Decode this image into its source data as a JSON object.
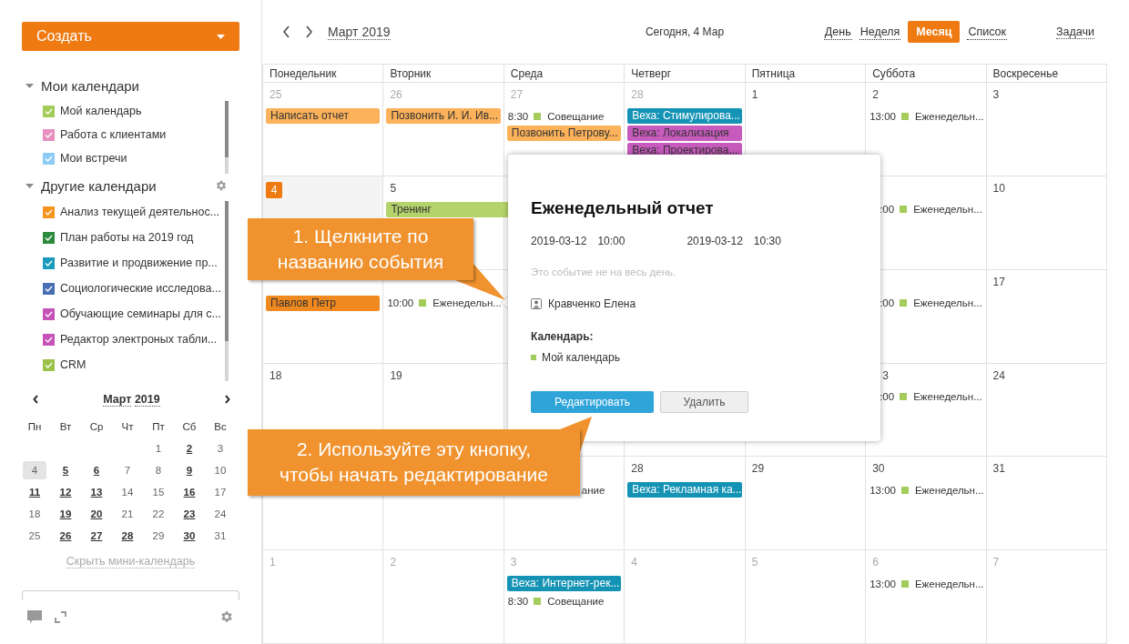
{
  "sidebar": {
    "create_button": "Создать",
    "sections": [
      {
        "title": "Мои календари",
        "expanded": true,
        "settings": false,
        "items": [
          {
            "label": "Мой календарь",
            "checked": true,
            "color": "#a4cc5a"
          },
          {
            "label": "Работа с клиентами",
            "checked": true,
            "color": "#e88fbf"
          },
          {
            "label": "Мои встречи",
            "checked": true,
            "color": "#8ecbf5"
          }
        ]
      },
      {
        "title": "Другие календари",
        "expanded": true,
        "settings": true,
        "items": [
          {
            "label": "Анализ текущей деятельнос...",
            "checked": true,
            "color": "#f7941d"
          },
          {
            "label": "План работы на 2019 год",
            "checked": true,
            "color": "#2e8b3e"
          },
          {
            "label": "Развитие и продвижение пр...",
            "checked": true,
            "color": "#1a9bbd"
          },
          {
            "label": "Социологические исследова...",
            "checked": true,
            "color": "#4a6fb5"
          },
          {
            "label": "Обучающие семинары для с...",
            "checked": true,
            "color": "#c653b8"
          },
          {
            "label": "Редактор электроных табли...",
            "checked": true,
            "color": "#c653b8"
          },
          {
            "label": "CRM",
            "checked": true,
            "color": "#9bc24a"
          }
        ]
      }
    ],
    "mini_calendar": {
      "month": "Март",
      "year": "2019",
      "weekdays": [
        "Пн",
        "Вт",
        "Ср",
        "Чт",
        "Пт",
        "Сб",
        "Вс"
      ],
      "weeks": [
        [
          {
            "day": "1",
            "bold": false,
            "selected": false
          },
          {
            "day": "2",
            "bold": true,
            "selected": false
          },
          {
            "day": "3",
            "bold": false,
            "selected": false
          }
        ],
        [
          {
            "day": "4",
            "bold": false,
            "selected": true
          },
          {
            "day": "5",
            "bold": true,
            "selected": false
          },
          {
            "day": "6",
            "bold": true,
            "selected": false
          },
          {
            "day": "7",
            "bold": false,
            "selected": false
          },
          {
            "day": "8",
            "bold": false,
            "selected": false
          },
          {
            "day": "9",
            "bold": true,
            "selected": false
          },
          {
            "day": "10",
            "bold": false,
            "selected": false
          }
        ],
        [
          {
            "day": "11",
            "bold": true,
            "selected": false
          },
          {
            "day": "12",
            "bold": true,
            "selected": false
          },
          {
            "day": "13",
            "bold": true,
            "selected": false
          },
          {
            "day": "14",
            "bold": false,
            "selected": false
          },
          {
            "day": "15",
            "bold": false,
            "selected": false
          },
          {
            "day": "16",
            "bold": true,
            "selected": false
          },
          {
            "day": "17",
            "bold": false,
            "selected": false
          }
        ],
        [
          {
            "day": "18",
            "bold": false,
            "selected": false
          },
          {
            "day": "19",
            "bold": true,
            "selected": false
          },
          {
            "day": "20",
            "bold": true,
            "selected": false
          },
          {
            "day": "21",
            "bold": false,
            "selected": false
          },
          {
            "day": "22",
            "bold": false,
            "selected": false
          },
          {
            "day": "23",
            "bold": true,
            "selected": false
          },
          {
            "day": "24",
            "bold": false,
            "selected": false
          }
        ],
        [
          {
            "day": "25",
            "bold": false,
            "selected": false
          },
          {
            "day": "26",
            "bold": true,
            "selected": false
          },
          {
            "day": "27",
            "bold": true,
            "selected": false
          },
          {
            "day": "28",
            "bold": true,
            "selected": false
          },
          {
            "day": "29",
            "bold": false,
            "selected": false
          },
          {
            "day": "30",
            "bold": true,
            "selected": false
          },
          {
            "day": "31",
            "bold": false,
            "selected": false
          }
        ]
      ],
      "hide_link": "Скрыть мини-календарь"
    }
  },
  "toolbar": {
    "month_label": "Март 2019",
    "today_label": "Сегодня, 4 Мар",
    "views": [
      {
        "label": "День",
        "selected": false
      },
      {
        "label": "Неделя",
        "selected": false
      },
      {
        "label": "Месяц",
        "selected": true
      },
      {
        "label": "Список",
        "selected": false
      }
    ],
    "tasks_link": "Задачи"
  },
  "grid": {
    "weekdays": [
      "Понедельник",
      "Вторник",
      "Среда",
      "Четверг",
      "Пятница",
      "Суббота",
      "Воскресенье"
    ],
    "weeks": [
      {
        "days": [
          {
            "kind": "day",
            "day": "25",
            "muted": true,
            "today": false,
            "events": [
              {
                "kind": "bar",
                "title": "Написать отчет",
                "color": "#fbb25a",
                "continues": false
              }
            ]
          },
          {
            "kind": "day",
            "day": "26",
            "muted": true,
            "today": false,
            "events": [
              {
                "kind": "bar",
                "title": "Позвонить И. И. Ив...",
                "color": "#fbb25a",
                "continues": false
              }
            ]
          },
          {
            "kind": "day",
            "day": "27",
            "muted": true,
            "today": false,
            "events": [
              {
                "kind": "timed",
                "time": "8:30",
                "title": "Совещание",
                "color": "#a4cc5a"
              },
              {
                "kind": "bar",
                "title": "Позвонить Петрову...",
                "color": "#fbb25a",
                "continues": false
              }
            ]
          },
          {
            "kind": "day",
            "day": "28",
            "muted": true,
            "today": false,
            "events": [
              {
                "kind": "bar",
                "title": "Веха: Стимулирова...",
                "color": "#1593b5",
                "continues": false
              },
              {
                "kind": "bar",
                "title": "Веха: Локализация",
                "color": "#c75bbd",
                "continues": false
              },
              {
                "kind": "bar",
                "title": "Веха: Проектирова...",
                "color": "#c75bbd",
                "continues": false
              }
            ]
          },
          {
            "kind": "day",
            "day": "1",
            "muted": false,
            "today": false
          },
          {
            "kind": "day",
            "day": "2",
            "muted": false,
            "today": false,
            "events": [
              {
                "kind": "timed",
                "time": "13:00",
                "title": "Еженедельн...",
                "color": "#a4cc5a"
              }
            ]
          },
          {
            "kind": "day",
            "day": "3",
            "muted": false,
            "today": false
          }
        ]
      },
      {
        "days": [
          {
            "kind": "day",
            "day": "4",
            "muted": false,
            "today": true
          },
          {
            "kind": "day",
            "day": "5",
            "muted": false,
            "today": false,
            "events": [
              {
                "kind": "bar",
                "title": "Тренинг",
                "color": "#b5d36b",
                "continues": true
              }
            ]
          },
          {
            "kind": "hidden"
          },
          {
            "kind": "covered"
          },
          {
            "kind": "covered"
          },
          {
            "kind": "clipped",
            "events": [
              {
                "kind": "timed",
                "time": ":00",
                "title": "Еженедельн...",
                "color": "#a4cc5a"
              }
            ]
          },
          {
            "kind": "day",
            "day": "10",
            "muted": false,
            "today": false
          }
        ]
      },
      {
        "days": [
          {
            "kind": "undated",
            "events": [
              {
                "kind": "bar",
                "title": "Павлов Петр",
                "color": "#f0891f",
                "continues": false
              }
            ]
          },
          {
            "kind": "undated",
            "events": [
              {
                "kind": "timed",
                "time": "10:00",
                "title": "Еженедельн...",
                "color": "#a4cc5a"
              }
            ]
          },
          {
            "kind": "hidden"
          },
          {
            "kind": "covered"
          },
          {
            "kind": "covered"
          },
          {
            "kind": "clipped",
            "events": [
              {
                "kind": "timed",
                "time": ":00",
                "title": "Еженедельн...",
                "color": "#a4cc5a"
              }
            ]
          },
          {
            "kind": "day",
            "day": "17",
            "muted": false,
            "today": false
          }
        ]
      },
      {
        "days": [
          {
            "kind": "day",
            "day": "18",
            "muted": false,
            "today": false
          },
          {
            "kind": "day",
            "day": "19",
            "muted": false,
            "today": false
          },
          {
            "kind": "hidden"
          },
          {
            "kind": "hidden"
          },
          {
            "kind": "hidden"
          },
          {
            "kind": "clipped",
            "day": "3",
            "events": [
              {
                "kind": "timed",
                "time": ":00",
                "title": "Еженедельн...",
                "color": "#a4cc5a"
              }
            ]
          },
          {
            "kind": "day",
            "day": "24",
            "muted": false,
            "today": false
          }
        ]
      },
      {
        "days": [
          {
            "kind": "hidden"
          },
          {
            "kind": "hidden"
          },
          {
            "kind": "behind-callout",
            "events": [
              {
                "kind": "text",
                "title": "ание"
              }
            ]
          },
          {
            "kind": "day",
            "day": "28",
            "muted": false,
            "today": false,
            "events": [
              {
                "kind": "bar",
                "title": "Веха: Рекламная ка...",
                "color": "#1593b5",
                "continues": false
              }
            ]
          },
          {
            "kind": "day",
            "day": "29",
            "muted": false,
            "today": false
          },
          {
            "kind": "day",
            "day": "30",
            "muted": false,
            "today": false,
            "events": [
              {
                "kind": "timed",
                "time": "13:00",
                "title": "Еженедельн...",
                "color": "#a4cc5a"
              }
            ]
          },
          {
            "kind": "day",
            "day": "31",
            "muted": false,
            "today": false
          }
        ]
      },
      {
        "days": [
          {
            "kind": "day",
            "day": "1",
            "muted": true,
            "today": false
          },
          {
            "kind": "day",
            "day": "2",
            "muted": true,
            "today": false
          },
          {
            "kind": "day",
            "day": "3",
            "muted": true,
            "today": false,
            "events": [
              {
                "kind": "bar",
                "title": "Веха: Интернет-рек...",
                "color": "#1593b5",
                "continues": false
              },
              {
                "kind": "timed",
                "time": "8:30",
                "title": "Совещание",
                "color": "#a4cc5a"
              }
            ]
          },
          {
            "kind": "day",
            "day": "4",
            "muted": true,
            "today": false
          },
          {
            "kind": "day",
            "day": "5",
            "muted": true,
            "today": false
          },
          {
            "kind": "day",
            "day": "6",
            "muted": true,
            "today": false,
            "events": [
              {
                "kind": "timed",
                "time": "13:00",
                "title": "Еженедельн...",
                "color": "#a4cc5a"
              }
            ]
          },
          {
            "kind": "day",
            "day": "7",
            "muted": true,
            "today": false
          }
        ]
      }
    ]
  },
  "popup": {
    "title": "Еженедельный отчет",
    "start_date": "2019-03-12",
    "start_time": "10:00",
    "end_date": "2019-03-12",
    "end_time": "10:30",
    "all_day_note": "Это событие не на весь день.",
    "organizer": "Кравченко Елена",
    "calendar_label": "Календарь:",
    "calendar": {
      "name": "Мой календарь",
      "color": "#a4cc5a"
    },
    "buttons": [
      {
        "label": "Редактировать",
        "kind": "primary"
      },
      {
        "label": "Удалить",
        "kind": "secondary"
      }
    ]
  },
  "callouts": [
    {
      "lines": [
        "1. Щелкните по",
        "названию события"
      ],
      "kind": "downward"
    },
    {
      "lines": [
        "2. Используйте эту кнопку,",
        "чтобы начать редактирование"
      ],
      "kind": "upward"
    }
  ]
}
